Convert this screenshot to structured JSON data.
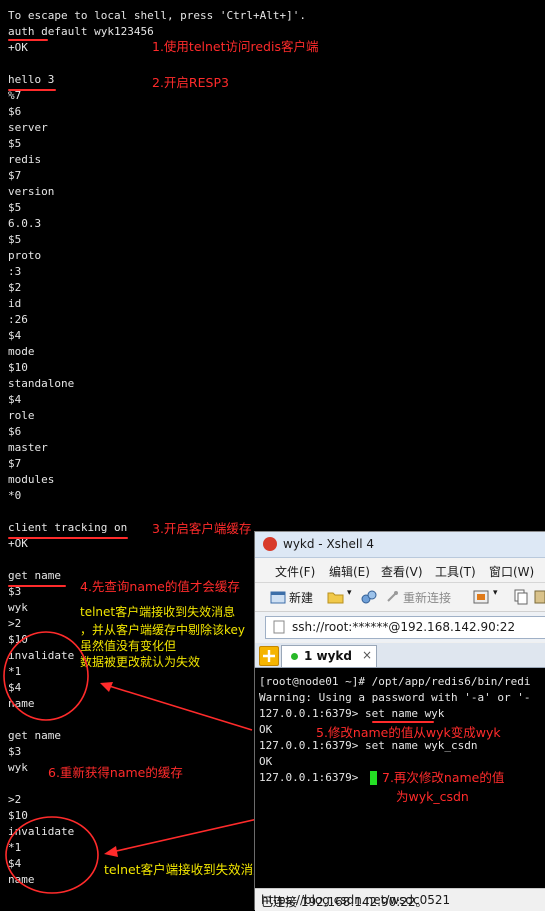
{
  "terminal": {
    "lines": [
      "To escape to local shell, press 'Ctrl+Alt+]'.",
      "auth default wyk123456",
      "+OK",
      "",
      "hello 3",
      "%7",
      "$6",
      "server",
      "$5",
      "redis",
      "$7",
      "version",
      "$5",
      "6.0.3",
      "$5",
      "proto",
      ":3",
      "$2",
      "id",
      ":26",
      "$4",
      "mode",
      "$10",
      "standalone",
      "$4",
      "role",
      "$6",
      "master",
      "$7",
      "modules",
      "*0",
      "",
      "client tracking on",
      "+OK",
      "",
      "get name",
      "$3",
      "wyk",
      ">2",
      "$10",
      "invalidate",
      "*1",
      "$4",
      "name",
      "",
      "get name",
      "$3",
      "wyk",
      "",
      ">2",
      "$10",
      "invalidate",
      "*1",
      "$4",
      "name"
    ]
  },
  "annotations": {
    "a1": "1.使用telnet访问redis客户端",
    "a2": "2.开启RESP3",
    "a3": "3.开启客户端缓存",
    "a4": "4.先查询name的值才会缓存",
    "a5": "5.修改name的值从wyk变成wyk",
    "a6": "6.重新获得name的缓存",
    "a7_1": "7.再次修改name的值",
    "a7_2": "为wyk_csdn",
    "y1_1": "telnet客户端接收到失效消息",
    "y1_2": "，并从客户端缓存中剔除该key",
    "y1_3": "虽然值没有变化但",
    "y1_4": "数据被更改就认为失效",
    "y2": "telnet客户端接收到失效消息，并从客户端缓存中剔除该key"
  },
  "xshell": {
    "title": "wykd - Xshell 4",
    "menu": [
      "文件(F)",
      "编辑(E)",
      "查看(V)",
      "工具(T)",
      "窗口(W)"
    ],
    "toolbar": {
      "new": "新建",
      "reconnect": "重新连接"
    },
    "address": "ssh://root:******@192.168.142.90:22",
    "tab_label": "1 wykd",
    "tab_close": "×",
    "term_lines": [
      "[root@node01 ~]# /opt/app/redis6/bin/redi",
      "Warning: Using a password with '-a' or '-",
      "127.0.0.1:6379> set name wyk",
      "OK",
      "127.0.0.1:6379> set name wyk_csdn",
      "OK",
      "127.0.0.1:6379> "
    ],
    "status": "已连接 192.168.142.90:22。",
    "watermark": "https://blog.csdn.net/wsdc0521"
  },
  "colors": {
    "annotation": "#ff2b2b",
    "note": "#f2e600",
    "terminal_bg": "#000000",
    "cursor": "#24e024"
  }
}
